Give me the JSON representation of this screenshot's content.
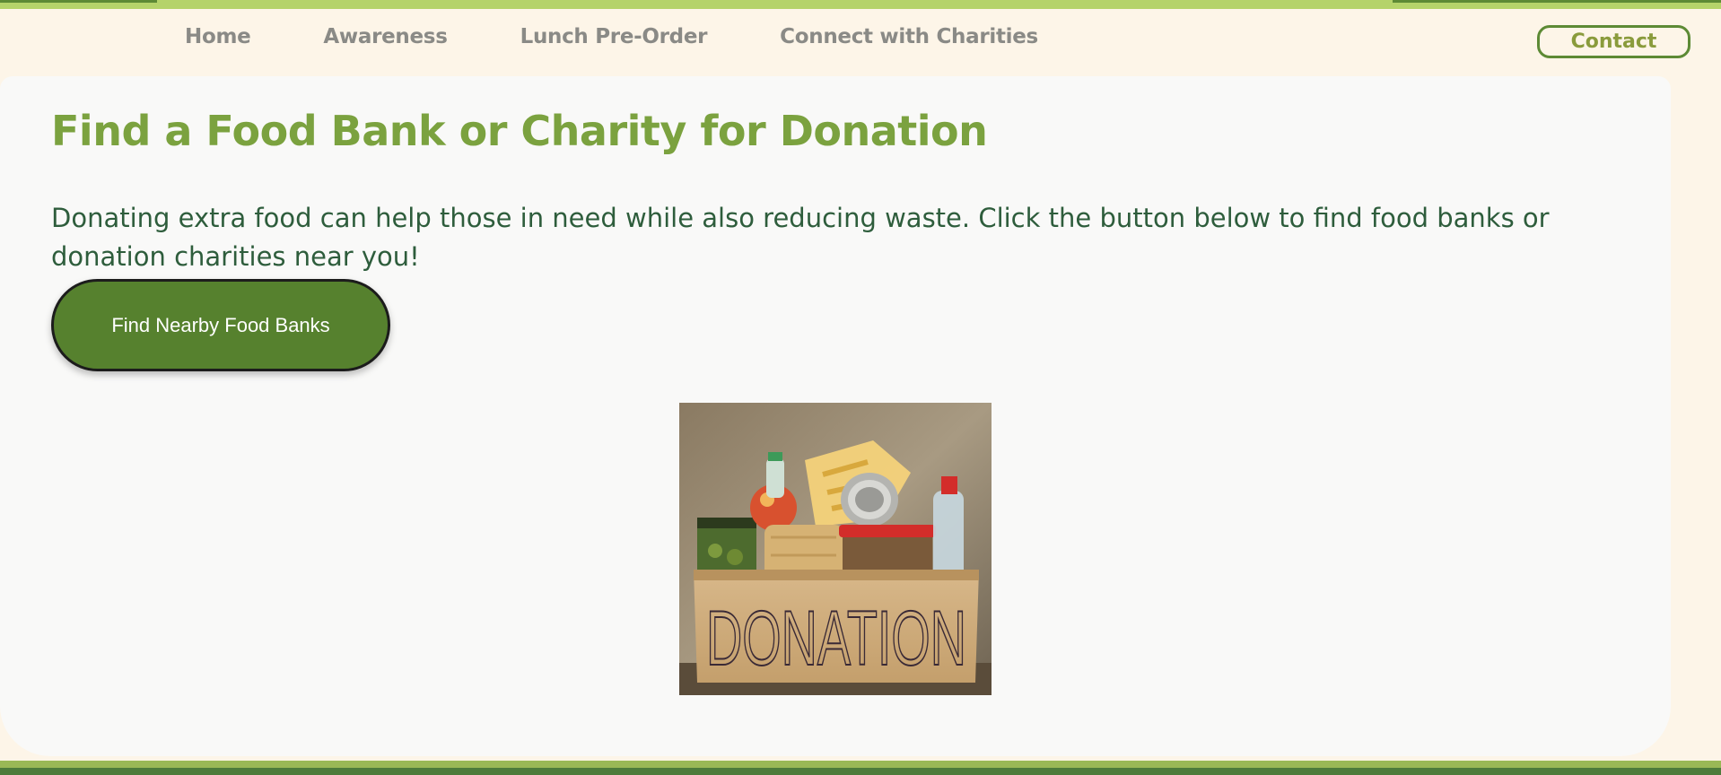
{
  "nav": {
    "items": [
      {
        "label": "Home"
      },
      {
        "label": "Awareness"
      },
      {
        "label": "Lunch Pre-Order"
      },
      {
        "label": "Connect with Charities"
      }
    ],
    "contact_label": "Contact"
  },
  "main": {
    "title": "Find a Food Bank or Charity for Donation",
    "intro": "Donating extra food can help those in need while also reducing waste. Click the button below to find food banks or donation charities near you!",
    "button_label": "Find Nearby Food Banks",
    "image": {
      "box_text": "DONATION",
      "icon": "donation-box-image"
    }
  },
  "colors": {
    "page_bg": "#fdf5e8",
    "card_bg": "#f9f9f8",
    "title": "#7ba23f",
    "text": "#2e5d3c",
    "button": "#56812e",
    "accent_light": "#b5d36a",
    "accent_dark": "#4d7b3b"
  }
}
